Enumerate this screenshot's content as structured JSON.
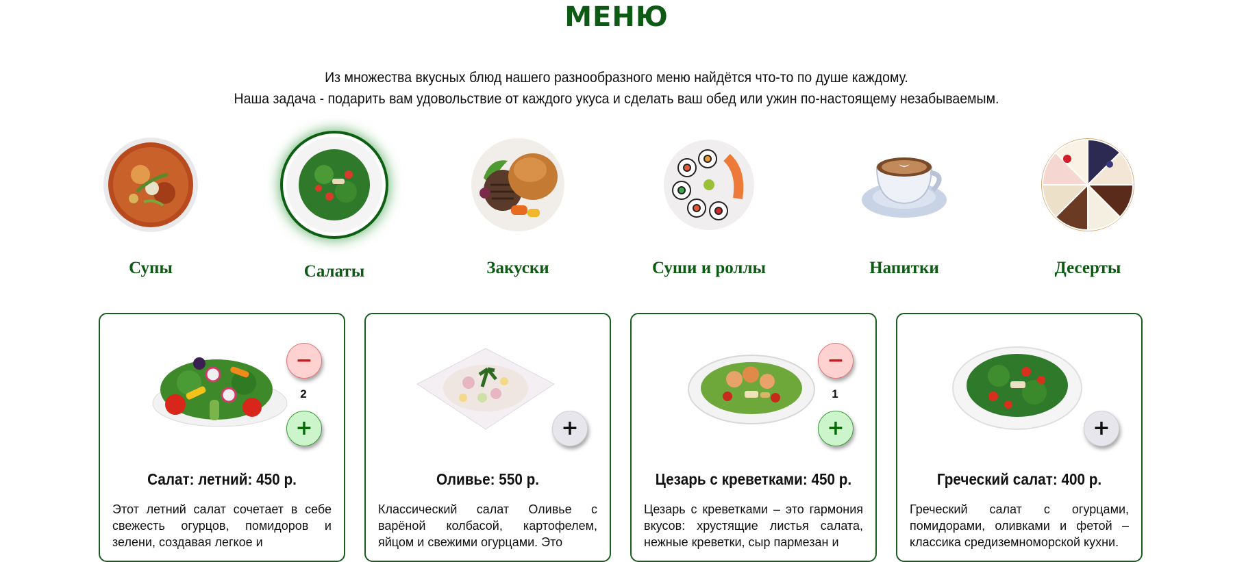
{
  "page": {
    "title": "МЕНЮ",
    "intro_line1": "Из множества вкусных блюд нашего разнообразного меню найдётся что-то по душе каждому.",
    "intro_line2": "Наша задача - подарить вам удовольствие от каждого укуса и сделать ваш обед или ужин по-настоящему незабываемым."
  },
  "colors": {
    "brand_green": "#0d5a14",
    "card_border": "#1a5c1e",
    "minus_bg": "#ffd2d2",
    "plus_active_bg": "#ccf5cc",
    "plus_neutral_bg": "#e6e6ec"
  },
  "categories": [
    {
      "label": "Супы",
      "icon": "soup-bowl-image",
      "active": false
    },
    {
      "label": "Салаты",
      "icon": "salad-plate-image",
      "active": true
    },
    {
      "label": "Закуски",
      "icon": "burger-plate-image",
      "active": false
    },
    {
      "label": "Суши и роллы",
      "icon": "sushi-plate-image",
      "active": false
    },
    {
      "label": "Напитки",
      "icon": "coffee-cup-image",
      "active": false
    },
    {
      "label": "Десерты",
      "icon": "cake-plate-image",
      "active": false
    }
  ],
  "dishes": [
    {
      "name": "Салат: летний: 450 р.",
      "description": "Этот летний салат сочетает в себе свежесть огурцов, помидоров и зелени, создавая легкое и",
      "quantity": "2",
      "minus_label": "−",
      "plus_label": "+"
    },
    {
      "name": "Оливье: 550 р.",
      "description": "Классический салат Оливье с варёной колбасой, картофелем, яйцом и свежими огурцами. Это",
      "quantity": "",
      "plus_label": "+"
    },
    {
      "name": "Цезарь с креветками: 450 р.",
      "description": "Цезарь с креветками – это гармония вкусов: хрустящие листья салата, нежные креветки, сыр пармезан и",
      "quantity": "1",
      "minus_label": "−",
      "plus_label": "+"
    },
    {
      "name": "Греческий салат: 400 р.",
      "description": "Греческий салат с огурцами, помидорами, оливками и фетой – классика средиземноморской кухни.",
      "quantity": "",
      "plus_label": "+"
    }
  ]
}
